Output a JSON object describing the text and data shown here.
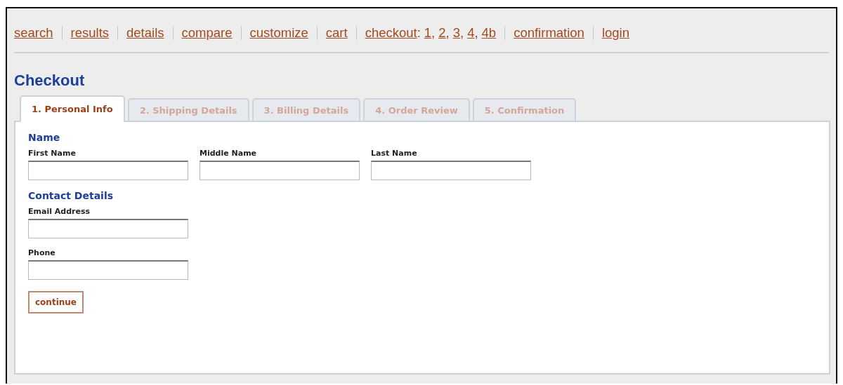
{
  "nav": [
    {
      "kind": "link",
      "label": "search"
    },
    {
      "kind": "link",
      "label": "results"
    },
    {
      "kind": "link",
      "label": "details"
    },
    {
      "kind": "link",
      "label": "compare"
    },
    {
      "kind": "link",
      "label": "customize"
    },
    {
      "kind": "link",
      "label": "cart"
    },
    {
      "kind": "steps",
      "label": "checkout",
      "suffix": ":",
      "steps": [
        {
          "label": "1",
          "suffix": ","
        },
        {
          "label": "2",
          "suffix": ","
        },
        {
          "label": "3",
          "suffix": ","
        },
        {
          "label": "4",
          "suffix": ","
        },
        {
          "label": "4b"
        }
      ]
    },
    {
      "kind": "link",
      "label": "confirmation"
    },
    {
      "kind": "link",
      "label": "login"
    }
  ],
  "heading": "Checkout",
  "tabs": [
    {
      "label": "1. Personal Info",
      "selected": true
    },
    {
      "label": "2. Shipping Details",
      "selected": false
    },
    {
      "label": "3. Billing Details",
      "selected": false
    },
    {
      "label": "4. Order Review",
      "selected": false
    },
    {
      "label": "5. Confirmation",
      "selected": false
    }
  ],
  "sections": [
    {
      "title": "Name",
      "kind": "row",
      "fields": [
        {
          "label": "First Name"
        },
        {
          "label": "Middle Name"
        },
        {
          "label": "Last Name"
        }
      ]
    },
    {
      "title": "Contact Details",
      "kind": "column",
      "fields": [
        {
          "label": "Email Address"
        },
        {
          "label": "Phone"
        }
      ]
    }
  ],
  "button": "continue"
}
